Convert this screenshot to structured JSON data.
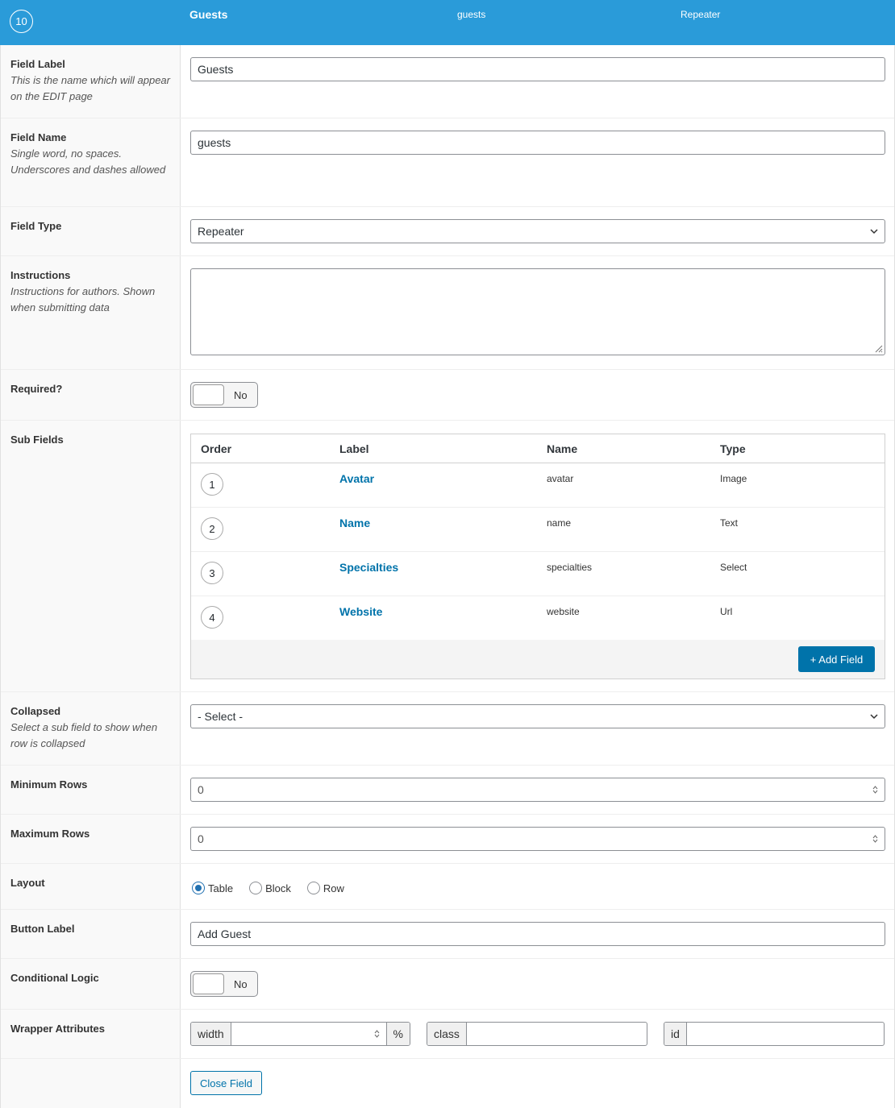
{
  "header": {
    "order": "10",
    "label": "Guests",
    "name": "guests",
    "type": "Repeater"
  },
  "fields": {
    "field_label": {
      "title": "Field Label",
      "desc": "This is the name which will appear on the EDIT page",
      "value": "Guests"
    },
    "field_name": {
      "title": "Field Name",
      "desc": "Single word, no spaces. Underscores and dashes allowed",
      "value": "guests"
    },
    "field_type": {
      "title": "Field Type",
      "value": "Repeater"
    },
    "instructions": {
      "title": "Instructions",
      "desc": "Instructions for authors. Shown when submitting data",
      "value": ""
    },
    "required": {
      "title": "Required?",
      "value": "No"
    },
    "sub_fields": {
      "title": "Sub Fields",
      "columns": [
        "Order",
        "Label",
        "Name",
        "Type"
      ],
      "rows": [
        {
          "order": "1",
          "label": "Avatar",
          "name": "avatar",
          "type": "Image"
        },
        {
          "order": "2",
          "label": "Name",
          "name": "name",
          "type": "Text"
        },
        {
          "order": "3",
          "label": "Specialties",
          "name": "specialties",
          "type": "Select"
        },
        {
          "order": "4",
          "label": "Website",
          "name": "website",
          "type": "Url"
        }
      ],
      "add_button": "+ Add Field"
    },
    "collapsed": {
      "title": "Collapsed",
      "desc": "Select a sub field to show when row is collapsed",
      "value": "- Select -"
    },
    "min_rows": {
      "title": "Minimum Rows",
      "value": "0"
    },
    "max_rows": {
      "title": "Maximum Rows",
      "value": "0"
    },
    "layout": {
      "title": "Layout",
      "options": [
        "Table",
        "Block",
        "Row"
      ],
      "selected": "Table"
    },
    "button_label": {
      "title": "Button Label",
      "value": "Add Guest"
    },
    "conditional_logic": {
      "title": "Conditional Logic",
      "value": "No"
    },
    "wrapper": {
      "title": "Wrapper Attributes",
      "width_label": "width",
      "width_suffix": "%",
      "class_label": "class",
      "id_label": "id"
    }
  },
  "close_button": "Close Field",
  "colors": {
    "header_bg": "#2a9bd9",
    "link": "#0073aa",
    "primary_button": "#0073aa"
  },
  "icons": {
    "select": "chevron-down-icon",
    "number": "spinner-icon",
    "textarea": "resize-grip-icon"
  }
}
